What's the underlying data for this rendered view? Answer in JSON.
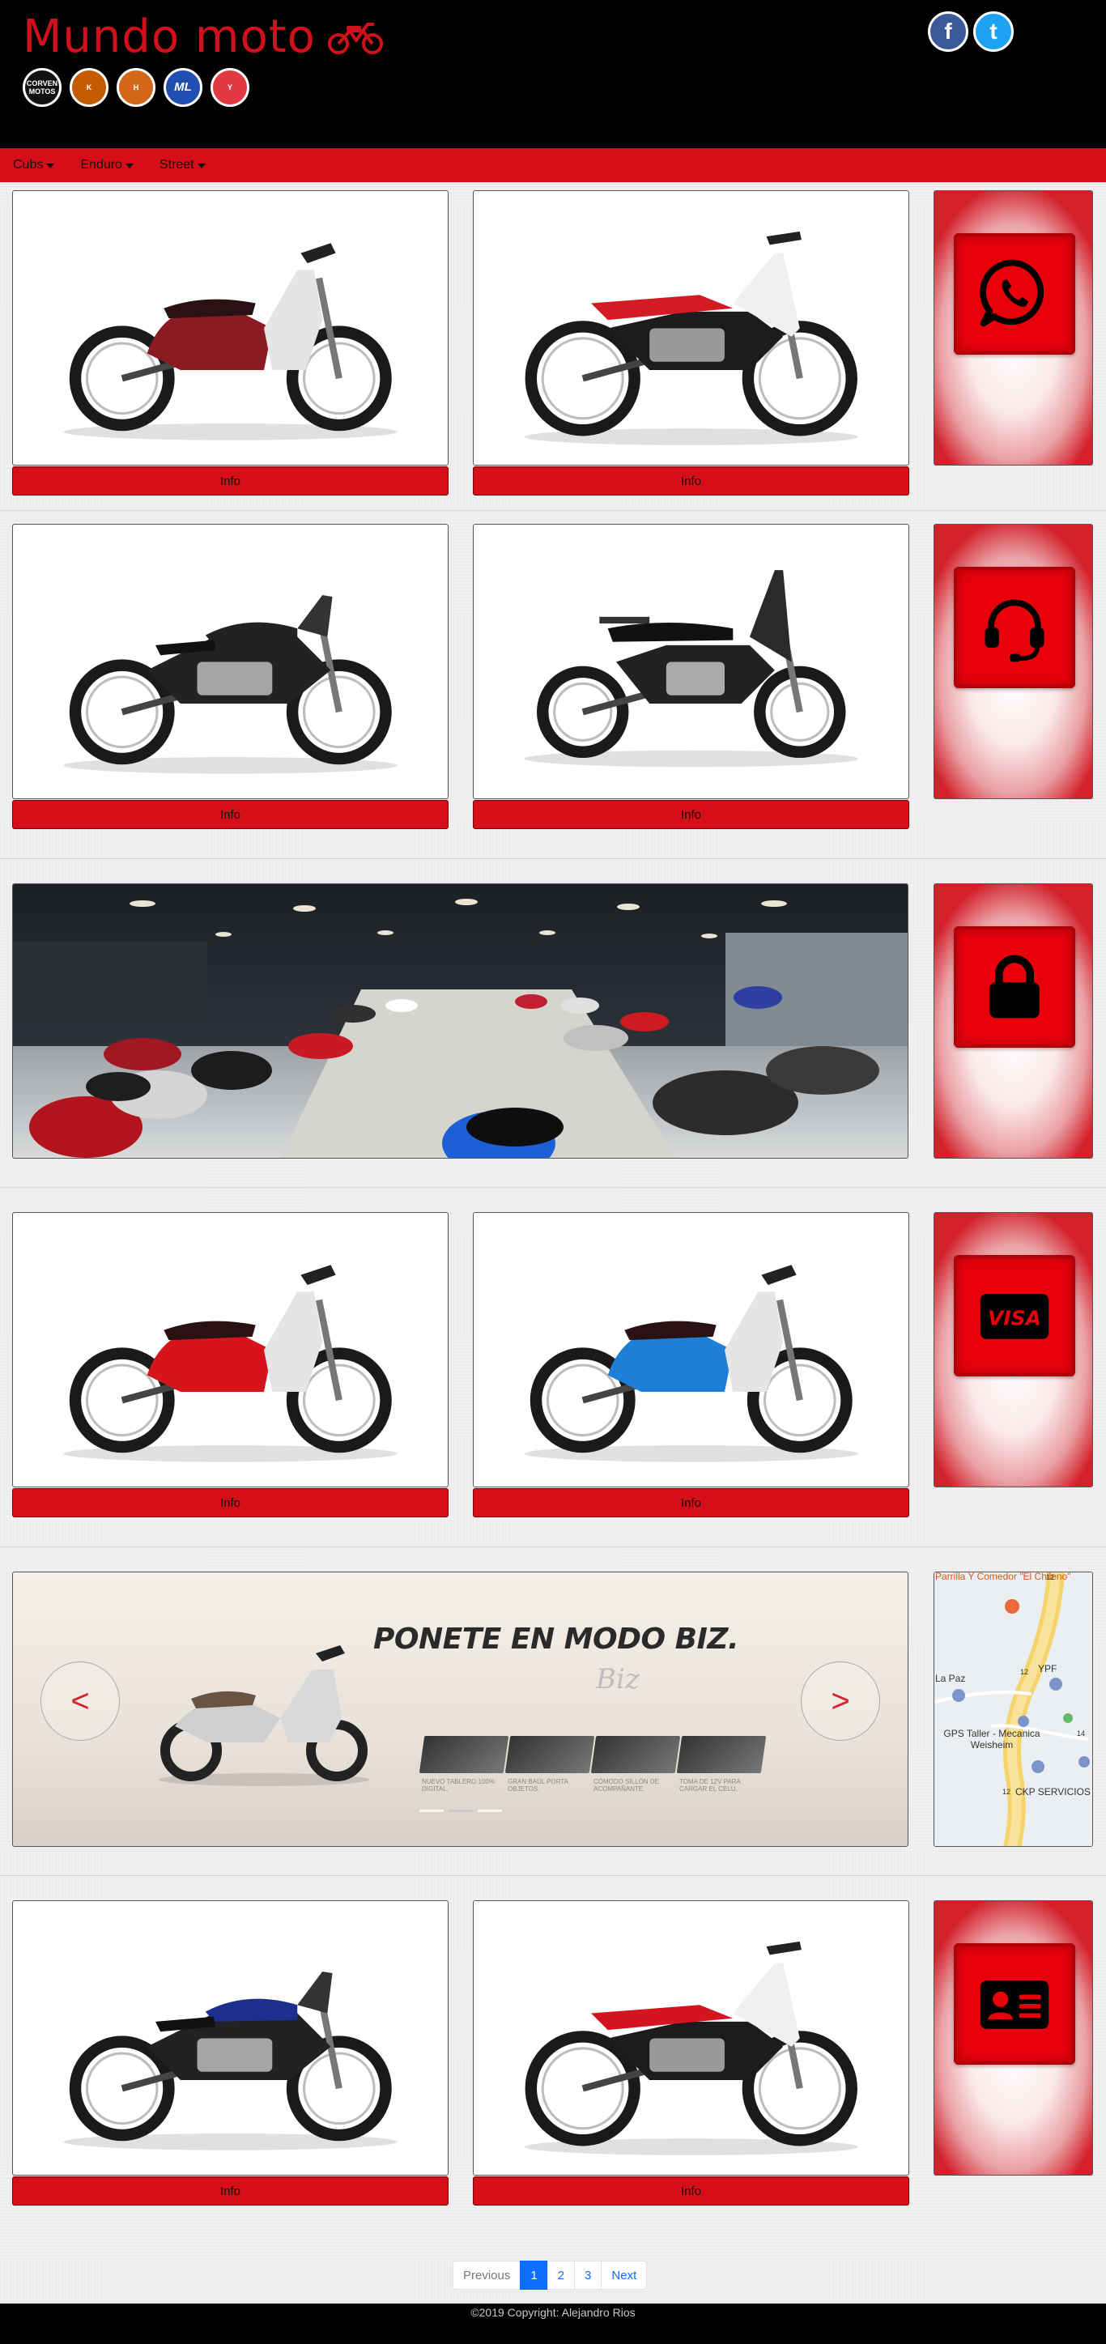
{
  "header": {
    "title": "Mundo moto",
    "brands": [
      {
        "name": "corven",
        "label": "CORVEN MOTOS"
      },
      {
        "name": "keeway",
        "label": "K"
      },
      {
        "name": "honda",
        "label": "H"
      },
      {
        "name": "ml",
        "label": "ML"
      },
      {
        "name": "yamaha",
        "label": "Y"
      }
    ],
    "social": {
      "facebook": "f",
      "twitter": "t"
    }
  },
  "nav": {
    "items": [
      "Cubs",
      "Enduro",
      "Street"
    ]
  },
  "products": {
    "info_label": "Info",
    "rows": [
      [
        {
          "color": "#8b1a23",
          "style": "cub"
        },
        {
          "color": "#d41b24",
          "style": "enduro"
        }
      ],
      [
        {
          "color": "#222222",
          "style": "street"
        },
        {
          "color": "#222222",
          "style": "mini"
        }
      ],
      [
        {
          "color": "#d6141c",
          "style": "cub"
        },
        {
          "color": "#1e7fd6",
          "style": "cub"
        }
      ],
      [
        {
          "color": "#1c2f8f",
          "style": "street"
        },
        {
          "color": "#d4141f",
          "style": "enduro"
        }
      ]
    ]
  },
  "side_icons": [
    "whatsapp-icon",
    "headset-icon",
    "lock-icon",
    "visa-card-icon",
    "id-card-icon"
  ],
  "side_text": {
    "visa": "VISA"
  },
  "carousel": {
    "title": "PONETE EN MODO BIZ.",
    "subtitle": "Biz",
    "prev": "<",
    "next": ">",
    "features": [
      "NUEVO TABLERO 100% DIGITAL.",
      "GRAN BAÚL PORTA OBJETOS.",
      "CÓMODO SILLÓN DE ACOMPAÑANTE.",
      "TOMA DE 12V PARA CARGAR EL CELU."
    ]
  },
  "map": {
    "labels": [
      "Parrilla Y Comedor \"El Chileno\"",
      "YPF",
      "La Paz",
      "GPS Taller - Mecanica Weisheim",
      "CKP SERVICIOS",
      "12",
      "12",
      "12",
      "14"
    ]
  },
  "pagination": {
    "previous": "Previous",
    "pages": [
      "1",
      "2",
      "3"
    ],
    "active": "1",
    "next": "Next"
  },
  "footer": {
    "text": "©2019 Copyright: Alejandro Rios"
  },
  "colors": {
    "brand_red": "#d60e17",
    "header_bg": "#000000",
    "link_blue": "#0d6efd"
  }
}
